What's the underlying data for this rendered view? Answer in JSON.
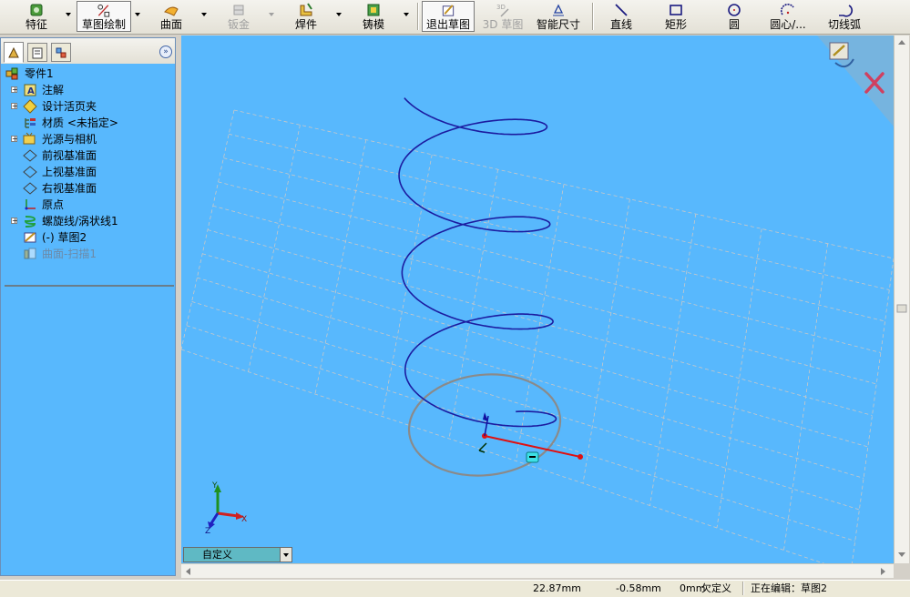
{
  "toolbar": {
    "features": "特征",
    "sketch": "草图绘制",
    "surfaces": "曲面",
    "sheet_metal": "钣金",
    "weldments": "焊件",
    "molds": "铸模",
    "exit_sketch": "退出草图",
    "sketch_3d": "3D 草图",
    "smart_dimension": "智能尺寸",
    "line": "直线",
    "rectangle": "矩形",
    "circle": "圆",
    "center_arc": "圆心/...",
    "tangent_arc": "切线弧"
  },
  "panel": {
    "expand_symbol": "»"
  },
  "tree": {
    "root": "零件1",
    "items": [
      {
        "label": "注解",
        "icon": "annotation-icon",
        "expandable": true
      },
      {
        "label": "设计活页夹",
        "icon": "design-binder-icon",
        "expandable": true
      },
      {
        "label": "材质 <未指定>",
        "icon": "material-icon",
        "expandable": false
      },
      {
        "label": "光源与相机",
        "icon": "lights-camera-icon",
        "expandable": true
      },
      {
        "label": "前视基准面",
        "icon": "plane-icon",
        "expandable": false
      },
      {
        "label": "上视基准面",
        "icon": "plane-icon",
        "expandable": false
      },
      {
        "label": "右视基准面",
        "icon": "plane-icon",
        "expandable": false
      },
      {
        "label": "原点",
        "icon": "origin-icon",
        "expandable": false
      },
      {
        "label": "螺旋线/涡状线1",
        "icon": "helix-icon",
        "expandable": true
      },
      {
        "label": "(-) 草图2",
        "icon": "sketch-icon",
        "expandable": false
      },
      {
        "label": "曲面-扫描1",
        "icon": "surface-sweep-icon",
        "expandable": false,
        "suppressed": true
      }
    ]
  },
  "viewport": {
    "view_orientation": "自定义",
    "axis_labels": {
      "x": "X",
      "y": "Y",
      "z": "Z"
    },
    "colors": {
      "background": "#58b8fd",
      "helix": "#1c1ca0",
      "sketch_circle": "#8a8a8a",
      "dimension_line": "#e01010",
      "grid": "#c8c8c8"
    }
  },
  "status": {
    "x": "22.87mm",
    "y": "-0.58mm",
    "z": "0mm",
    "definition": "欠定义",
    "editing": "正在编辑：草图2"
  }
}
